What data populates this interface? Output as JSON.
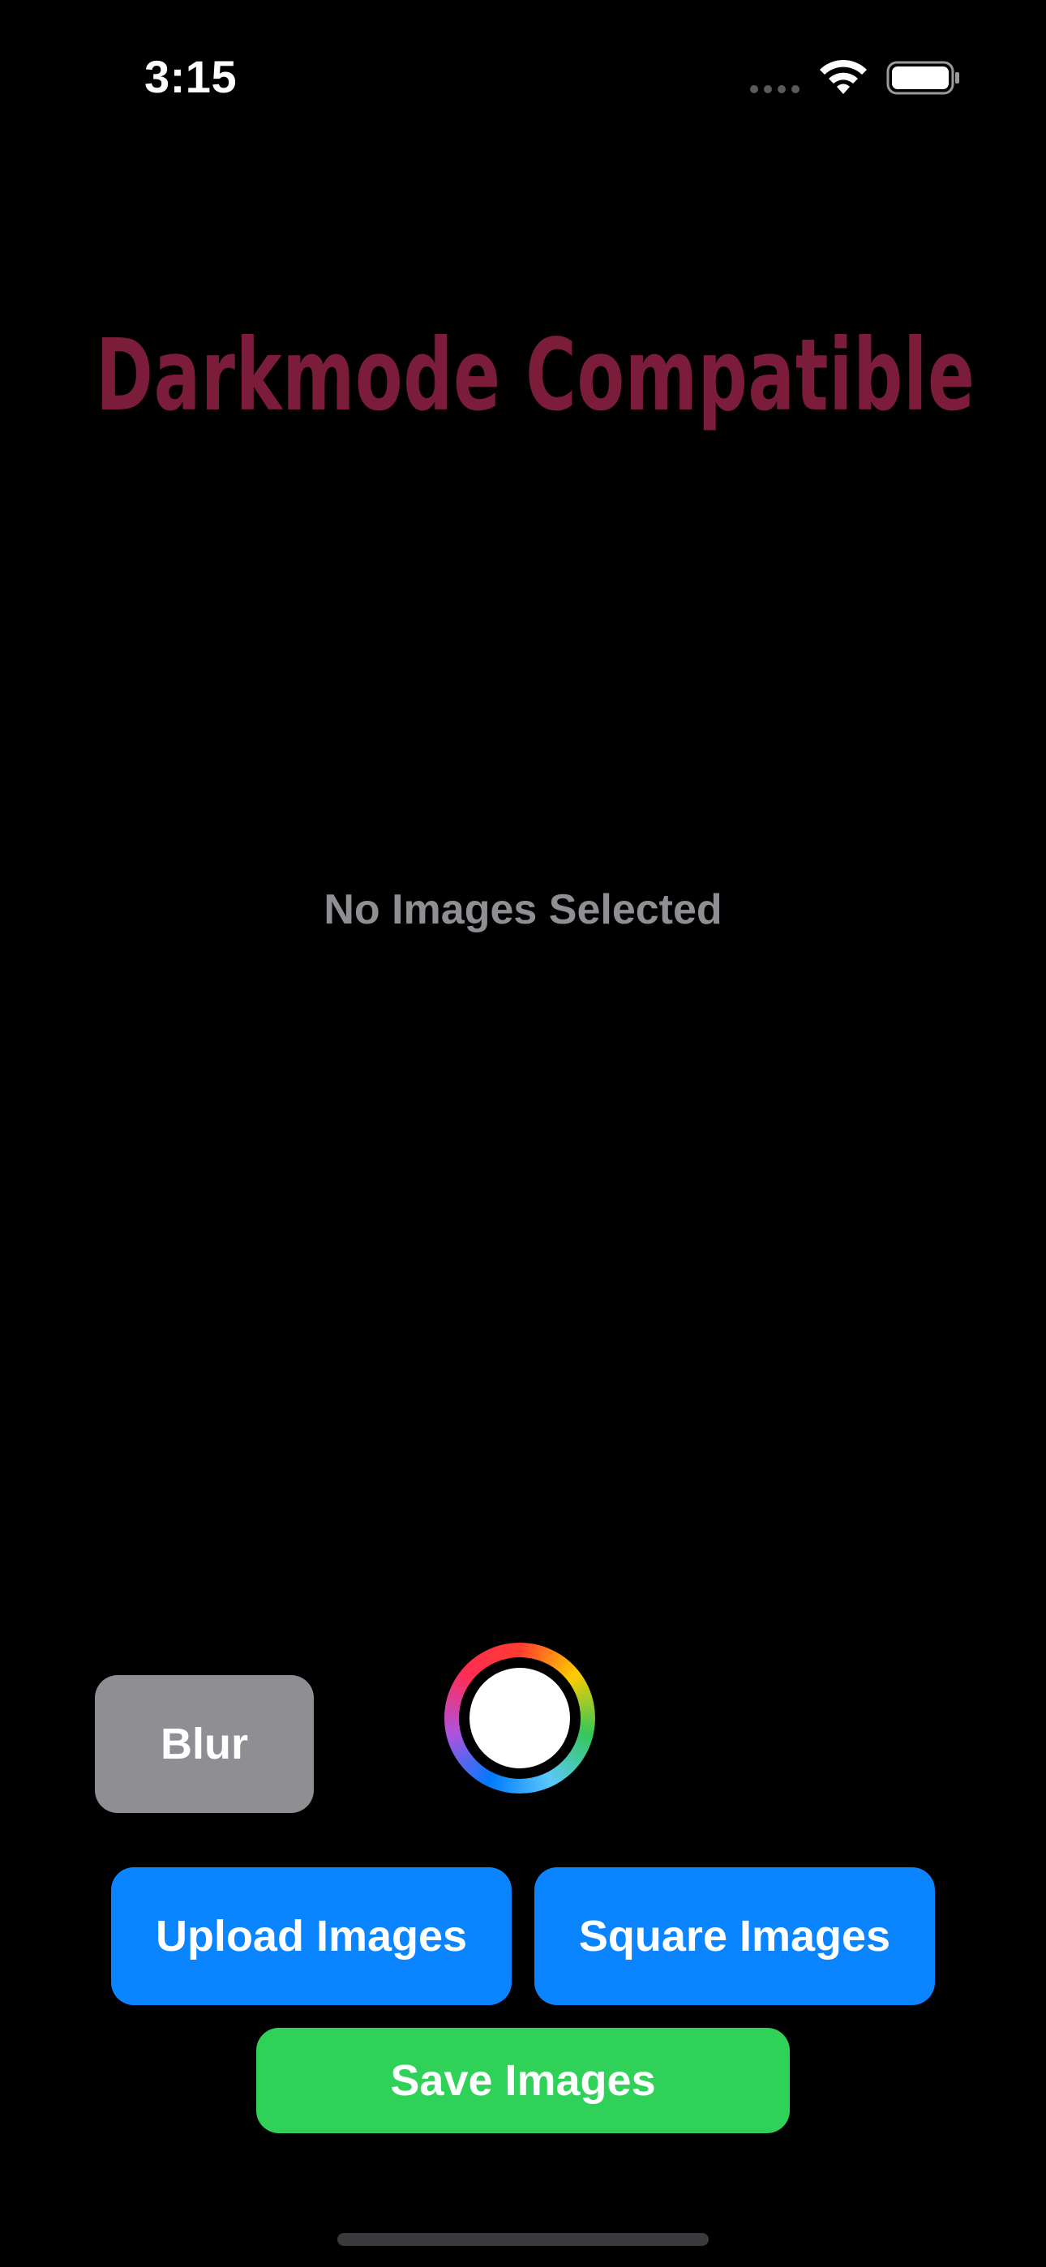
{
  "status_bar": {
    "time": "3:15",
    "icons": [
      "cellular-signal-icon",
      "wifi-icon",
      "battery-icon"
    ]
  },
  "header": {
    "title": "Darkmode Compatible",
    "title_color": "#7a1c3a"
  },
  "main": {
    "empty_message": "No Images Selected"
  },
  "controls": {
    "blur_label": "Blur",
    "color_well_selected": "#ffffff"
  },
  "actions": {
    "upload_label": "Upload Images",
    "square_label": "Square Images",
    "save_label": "Save Images"
  },
  "colors": {
    "background": "#000000",
    "primary_button": "#0a84ff",
    "save_button": "#30d158",
    "blur_button": "#8e8e93",
    "secondary_text": "#8e8e93"
  }
}
